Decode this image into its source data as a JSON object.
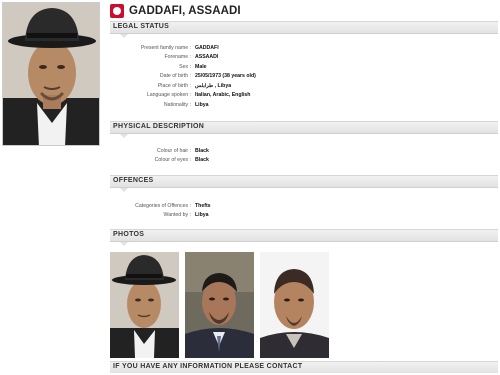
{
  "header": {
    "name": "GADDAFI, ASSAADI",
    "icon": "red-notice-icon"
  },
  "legal_status": {
    "title": "LEGAL STATUS",
    "rows": [
      {
        "label": "Present family name :",
        "value": "GADDAFI"
      },
      {
        "label": "Forename :",
        "value": "ASSAADI"
      },
      {
        "label": "Sex :",
        "value": "Male"
      },
      {
        "label": "Date of birth :",
        "value": "25/05/1973 (38 years old)"
      },
      {
        "label": "Place of birth :",
        "value": "طرابلس , Libya"
      },
      {
        "label": "Language spoken :",
        "value": "Italian, Arabic, English"
      },
      {
        "label": "Nationality :",
        "value": "Libya"
      }
    ]
  },
  "physical_description": {
    "title": "PHYSICAL DESCRIPTION",
    "rows": [
      {
        "label": "Colour of hair :",
        "value": "Black"
      },
      {
        "label": "Colour of eyes :",
        "value": "Black"
      }
    ]
  },
  "offences": {
    "title": "OFFENCES",
    "rows": [
      {
        "label": "Categories of Offences :",
        "value": "Thefts"
      },
      {
        "label": "Wanted by :",
        "value": "Libya"
      }
    ]
  },
  "photos": {
    "title": "PHOTOS"
  },
  "contact": {
    "title": "IF YOU HAVE ANY INFORMATION PLEASE CONTACT"
  },
  "colors": {
    "notice_red": "#c8102e",
    "section_bg": "#e6e6e6"
  }
}
